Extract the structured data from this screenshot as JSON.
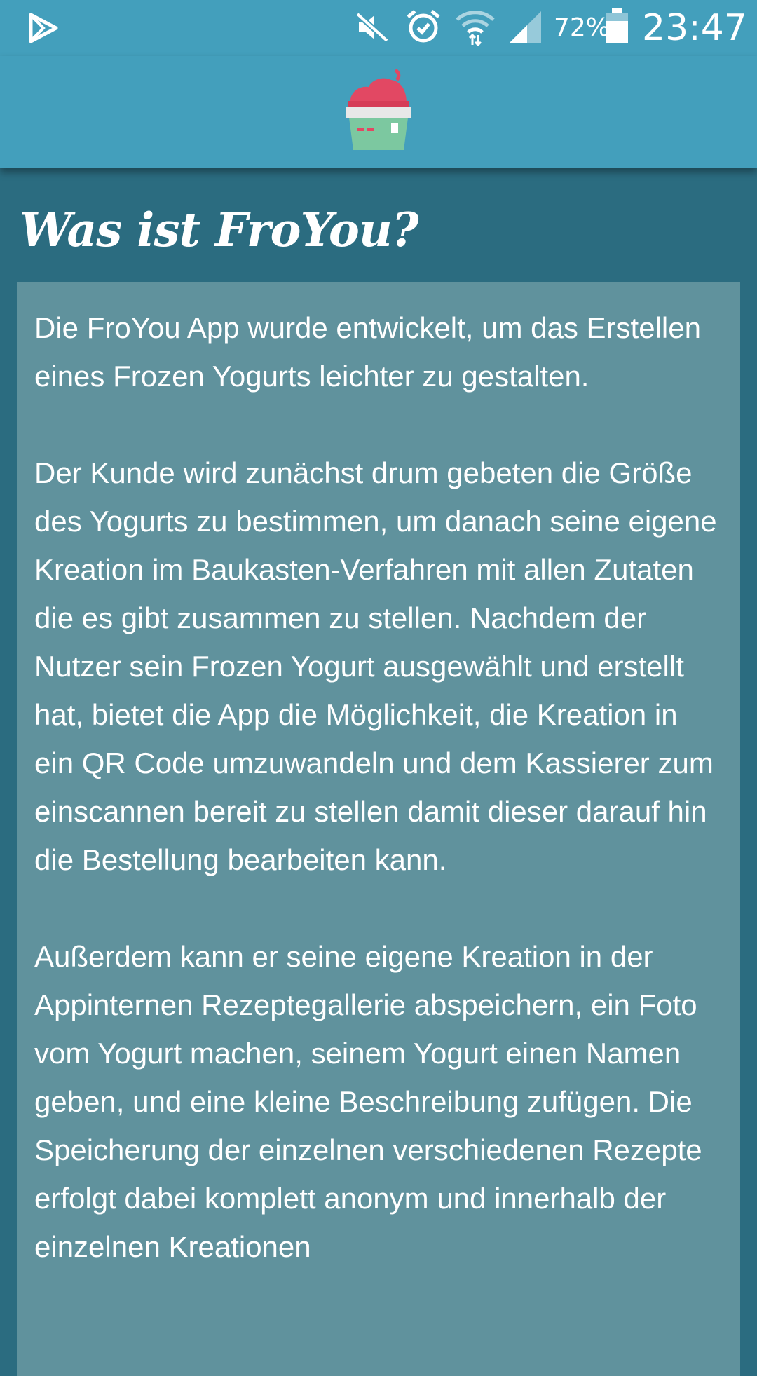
{
  "status_bar": {
    "icons": [
      "play-store-icon",
      "mute-icon",
      "alarm-icon",
      "wifi-icon",
      "signal-icon",
      "battery-icon"
    ],
    "battery": "72%",
    "battery_level": 0.72,
    "time": "23:47"
  },
  "app_bar": {
    "logo_icon": "froyo-cup-icon"
  },
  "page": {
    "title": "Was ist FroYou?",
    "paragraphs": [
      "Die FroYou App wurde entwickelt, um das Erstellen eines Frozen Yogurts leichter zu gestalten.",
      "Der Kunde wird zunächst drum gebeten die Größe des Yogurts zu bestimmen, um danach seine eigene Kreation im Baukasten-Verfahren mit allen Zutaten die es gibt zusammen zu stellen. Nachdem der Nutzer sein Frozen Yogurt ausgewählt und erstellt hat, bietet die App die Möglichkeit, die Kreation in ein QR Code umzuwandeln und dem Kassierer zum einscannen bereit zu stellen damit dieser darauf hin die Bestellung bearbeiten kann.",
      "Außerdem kann er seine eigene Kreation in der Appinternen Rezeptegallerie abspeichern, ein Foto vom Yogurt machen, seinem Yogurt einen Namen geben, und eine kleine Beschreibung zufügen. Die Speicherung der einzelnen verschiedenen Rezepte erfolgt dabei komplett anonym und innerhalb der einzelnen Kreationen"
    ]
  },
  "colors": {
    "app_bar": "#439fbc",
    "background": "#2b6c80",
    "card": "#60929d",
    "text": "#ffffff"
  }
}
